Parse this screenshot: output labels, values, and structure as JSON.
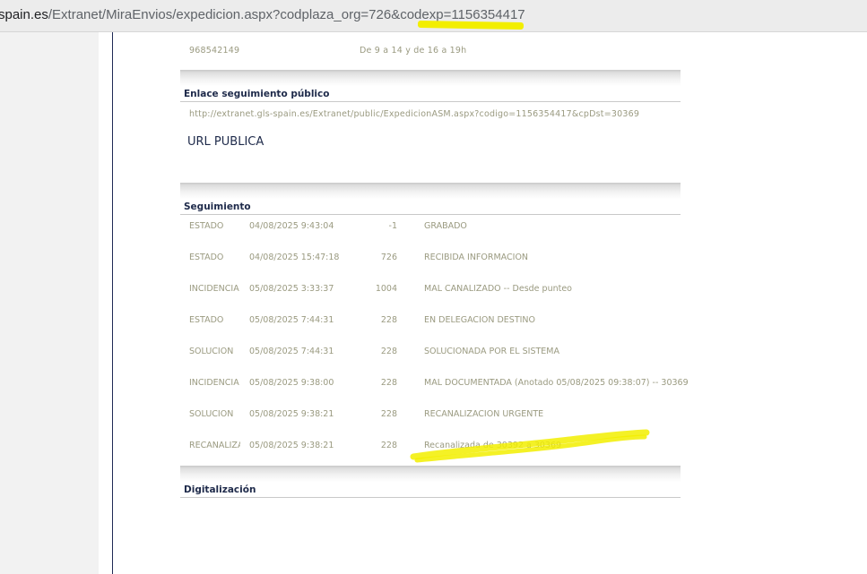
{
  "address_bar": {
    "host_fragment": "spain.es",
    "path": "/Extranet/MiraEnvios/expedicion.aspx?codplaza_org=726&codexp=1156354417"
  },
  "contact": {
    "phone": "968542149",
    "hours": "De 9 a 14 y de 16 a 19h"
  },
  "enlace": {
    "title": "Enlace seguimiento público",
    "url": "http://extranet.gls-spain.es/Extranet/public/ExpedicionASM.aspx?codigo=1156354417&cpDst=30369",
    "public_label": "URL PUBLICA"
  },
  "seguimiento": {
    "title": "Seguimiento",
    "rows": [
      {
        "type": "ESTADO",
        "date": "04/08/2025 9:43:04",
        "code": "-1",
        "desc": "GRABADO"
      },
      {
        "type": "ESTADO",
        "date": "04/08/2025 15:47:18",
        "code": "726",
        "desc": "RECIBIDA INFORMACION"
      },
      {
        "type": "INCIDENCIA",
        "date": "05/08/2025 3:33:37",
        "code": "1004",
        "desc": "MAL CANALIZADO -- Desde punteo"
      },
      {
        "type": "ESTADO",
        "date": "05/08/2025 7:44:31",
        "code": "228",
        "desc": "EN DELEGACION DESTINO"
      },
      {
        "type": "SOLUCION",
        "date": "05/08/2025 7:44:31",
        "code": "228",
        "desc": "SOLUCIONADA POR EL SISTEMA"
      },
      {
        "type": "INCIDENCIA",
        "date": "05/08/2025 9:38:00",
        "code": "228",
        "desc": "MAL DOCUMENTADA (Anotado 05/08/2025 09:38:07) -- 30369"
      },
      {
        "type": "SOLUCION",
        "date": "05/08/2025 9:38:21",
        "code": "228",
        "desc": "RECANALIZACION URGENTE"
      },
      {
        "type": "RECANALIZA",
        "date": "05/08/2025 9:38:21",
        "code": "228",
        "desc": "Recanalizada de 30392 a 30369"
      }
    ]
  },
  "digitalizacion": {
    "title": "Digitalización"
  },
  "colors": {
    "highlight": "#f2ee00",
    "muted_text": "#9a9a80",
    "heading_text": "#1e2a4a"
  }
}
